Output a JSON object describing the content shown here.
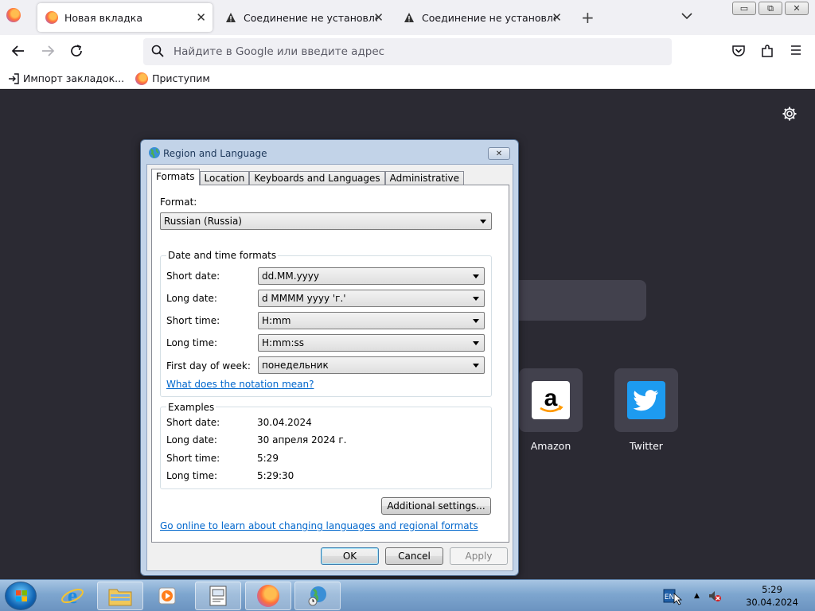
{
  "browser": {
    "tabs": [
      {
        "label": "Новая вкладка",
        "active": true
      },
      {
        "label": "Соединение не установлено:",
        "active": false
      },
      {
        "label": "Соединение не установлено:",
        "active": false
      }
    ],
    "window_controls": {
      "minimize": "▭",
      "restore": "⧉",
      "close": "✕"
    },
    "urlbar": {
      "placeholder": "Найдите в Google или введите адрес"
    },
    "bookmarks": [
      {
        "label": "Импорт закладок...",
        "icon": "import-icon"
      },
      {
        "label": "Приступим",
        "icon": "firefox-icon"
      }
    ],
    "top_sites": [
      {
        "label": "Amazon",
        "icon": "amazon-logo"
      },
      {
        "label": "Twitter",
        "icon": "twitter-logo"
      }
    ]
  },
  "dialog": {
    "title": "Region and Language",
    "tabs": [
      "Formats",
      "Location",
      "Keyboards and Languages",
      "Administrative"
    ],
    "format_label": "Format:",
    "format_value": "Russian (Russia)",
    "datetime_group": "Date and time formats",
    "fields": [
      {
        "label": "Short date:",
        "value": "dd.MM.yyyy"
      },
      {
        "label": "Long date:",
        "value": "d MMMM yyyy 'г.'"
      },
      {
        "label": "Short time:",
        "value": "H:mm"
      },
      {
        "label": "Long time:",
        "value": "H:mm:ss"
      },
      {
        "label": "First day of week:",
        "value": "понедельник"
      }
    ],
    "notation_link": "What does the notation mean?",
    "examples_group": "Examples",
    "examples": [
      {
        "label": "Short date:",
        "value": "30.04.2024"
      },
      {
        "label": "Long date:",
        "value": "30 апреля 2024 г."
      },
      {
        "label": "Short time:",
        "value": "5:29"
      },
      {
        "label": "Long time:",
        "value": "5:29:30"
      }
    ],
    "additional_button": "Additional settings...",
    "online_link": "Go online to learn about changing languages and regional formats",
    "ok": "OK",
    "cancel": "Cancel",
    "apply": "Apply"
  },
  "taskbar": {
    "clock_time": "5:29",
    "clock_date": "30.04.2024",
    "tray_arrow": "▲"
  }
}
